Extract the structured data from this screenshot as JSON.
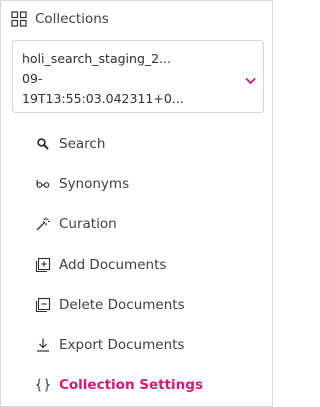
{
  "header": {
    "title": "Collections",
    "icon": "grid-icon"
  },
  "collection_select": {
    "value_lines": [
      "holi_search_staging_2...",
      "09-",
      "19T13:55:03.042311+0..."
    ],
    "chevron_color": "#e0137a"
  },
  "menu": {
    "items": [
      {
        "label": "Search",
        "icon": "search-icon"
      },
      {
        "label": "Synonyms",
        "icon": "synonyms-icon"
      },
      {
        "label": "Curation",
        "icon": "magic-wand-icon"
      },
      {
        "label": "Add Documents",
        "icon": "add-document-icon"
      },
      {
        "label": "Delete Documents",
        "icon": "delete-document-icon"
      },
      {
        "label": "Export Documents",
        "icon": "download-icon"
      },
      {
        "label": "Collection Settings",
        "icon": "braces-icon",
        "active": true
      }
    ]
  },
  "colors": {
    "accent": "#e0137a",
    "text": "#3f3f3f",
    "border": "#d6d6d6"
  }
}
